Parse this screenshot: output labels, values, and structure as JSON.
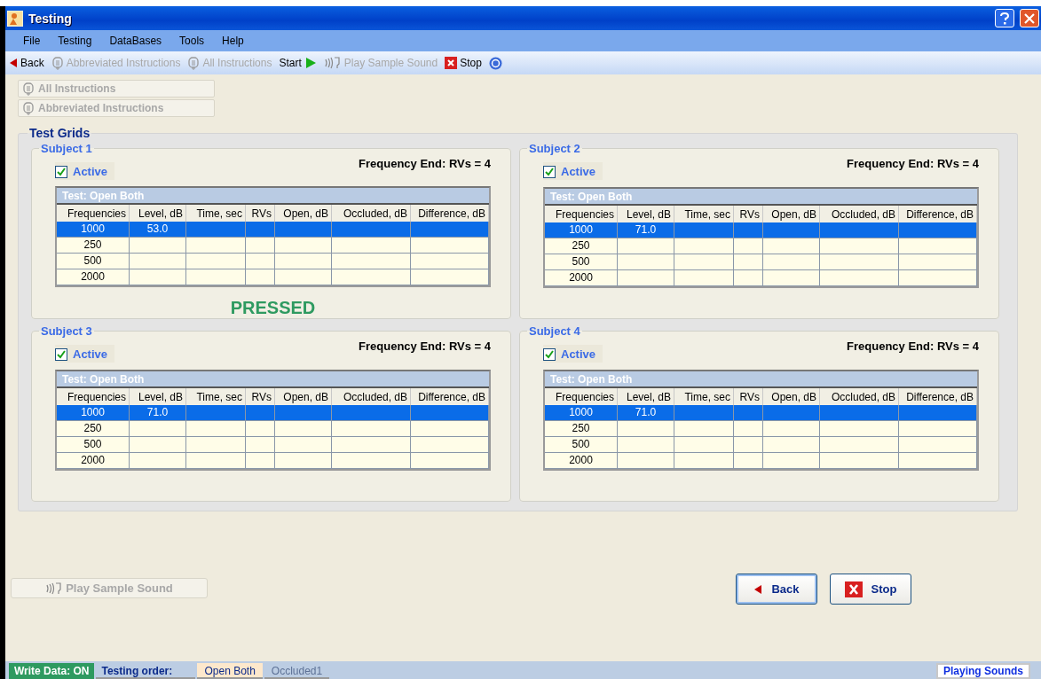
{
  "window": {
    "title": "Testing"
  },
  "menu": [
    "File",
    "Testing",
    "DataBases",
    "Tools",
    "Help"
  ],
  "toolbar": [
    {
      "kind": "back",
      "label": "Back",
      "disabled": false
    },
    {
      "kind": "instructions",
      "label": "Abbreviated Instructions",
      "disabled": true
    },
    {
      "kind": "instructions",
      "label": "All Instructions",
      "disabled": true
    },
    {
      "kind": "start",
      "label": "Start",
      "disabled": false
    },
    {
      "kind": "sound",
      "label": "Play Sample Sound",
      "disabled": true
    },
    {
      "kind": "stop",
      "label": "Stop",
      "disabled": false
    },
    {
      "kind": "help"
    }
  ],
  "instruction_buttons": [
    {
      "label": "All Instructions",
      "disabled": true
    },
    {
      "label": "Abbreviated Instructions",
      "disabled": true
    }
  ],
  "test_grids": {
    "title": "Test Grids",
    "subjects": [
      {
        "title": "Subject 1",
        "active_label": "Active",
        "active": true,
        "frequency_end": "Frequency End: RVs = 4",
        "test": "Test: Open Both",
        "columns": [
          "Frequencies",
          "Level, dB",
          "Time, sec",
          "RVs",
          "Open, dB",
          "Occluded, dB",
          "Difference, dB"
        ],
        "rows": [
          {
            "frequency": "1000",
            "level": "53.0",
            "selected": true
          },
          {
            "frequency": "250",
            "selected": false
          },
          {
            "frequency": "500",
            "selected": false
          },
          {
            "frequency": "2000",
            "selected": false
          }
        ],
        "status": "PRESSED"
      },
      {
        "title": "Subject 2",
        "active_label": "Active",
        "active": true,
        "frequency_end": "Frequency End: RVs = 4",
        "test": "Test: Open Both",
        "columns": [
          "Frequencies",
          "Level, dB",
          "Time, sec",
          "RVs",
          "Open, dB",
          "Occluded, dB",
          "Difference, dB"
        ],
        "rows": [
          {
            "frequency": "1000",
            "level": "71.0",
            "selected": true
          },
          {
            "frequency": "250",
            "selected": false
          },
          {
            "frequency": "500",
            "selected": false
          },
          {
            "frequency": "2000",
            "selected": false
          }
        ]
      },
      {
        "title": "Subject 3",
        "active_label": "Active",
        "active": true,
        "frequency_end": "Frequency End: RVs = 4",
        "test": "Test: Open Both",
        "columns": [
          "Frequencies",
          "Level, dB",
          "Time, sec",
          "RVs",
          "Open, dB",
          "Occluded, dB",
          "Difference, dB"
        ],
        "rows": [
          {
            "frequency": "1000",
            "level": "71.0",
            "selected": true
          },
          {
            "frequency": "250",
            "selected": false
          },
          {
            "frequency": "500",
            "selected": false
          },
          {
            "frequency": "2000",
            "selected": false
          }
        ]
      },
      {
        "title": "Subject 4",
        "active_label": "Active",
        "active": true,
        "frequency_end": "Frequency End: RVs = 4",
        "test": "Test: Open Both",
        "columns": [
          "Frequencies",
          "Level, dB",
          "Time, sec",
          "RVs",
          "Open, dB",
          "Occluded, dB",
          "Difference, dB"
        ],
        "rows": [
          {
            "frequency": "1000",
            "level": "71.0",
            "selected": true
          },
          {
            "frequency": "250",
            "selected": false
          },
          {
            "frequency": "500",
            "selected": false
          },
          {
            "frequency": "2000",
            "selected": false
          }
        ]
      }
    ]
  },
  "play_button": {
    "label": "Play Sample Sound",
    "disabled": true
  },
  "back_button": {
    "label": "Back"
  },
  "stop_button": {
    "label": "Stop"
  },
  "status_bar": {
    "write_data": "Write Data: ON",
    "order_label": "Testing order:",
    "orders": [
      {
        "label": "Open Both",
        "selected": true
      },
      {
        "label": "Occluded1",
        "selected": false
      }
    ],
    "status": "Playing Sounds"
  }
}
